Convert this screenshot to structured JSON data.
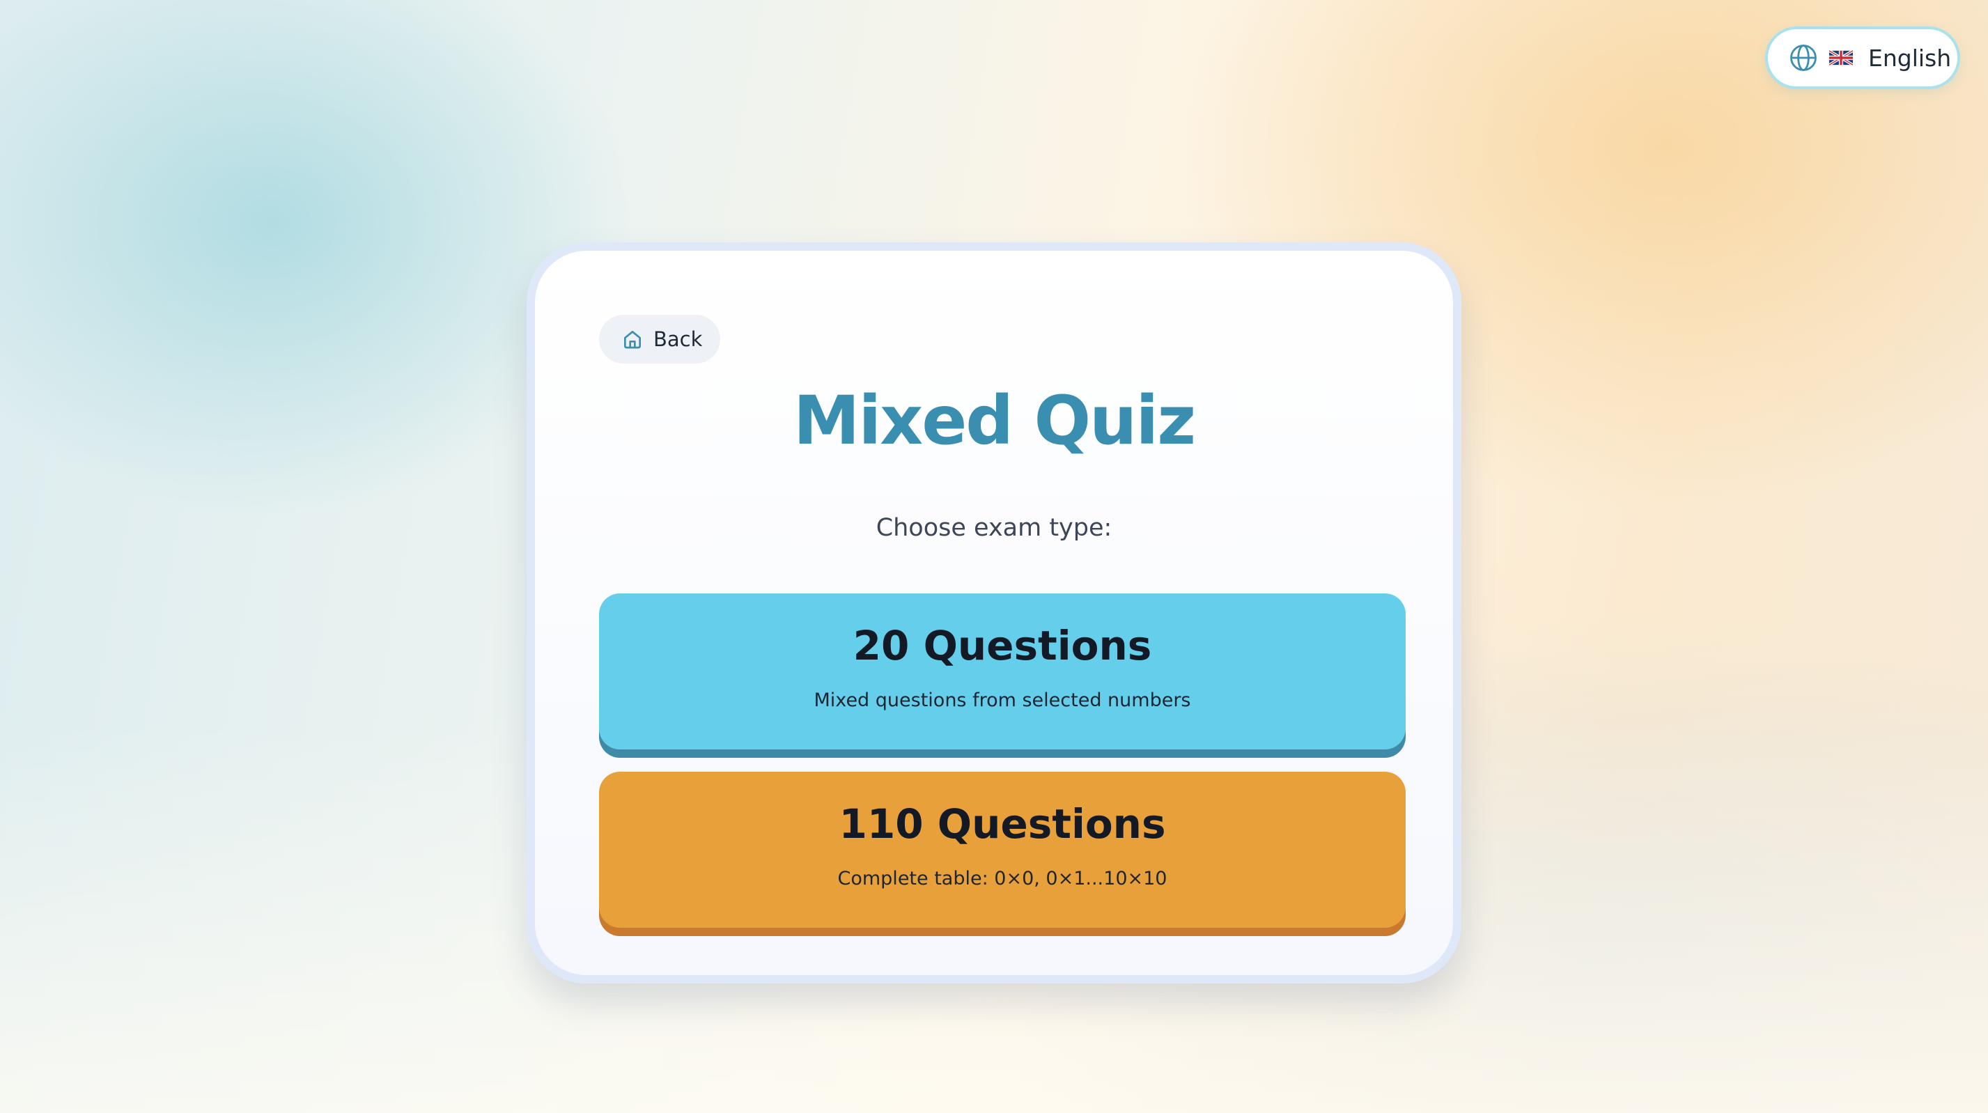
{
  "language": {
    "flag_icon": "uk-flag-icon",
    "globe_icon": "globe-icon",
    "label": "English"
  },
  "card": {
    "back_label": "Back",
    "back_icon": "home-icon",
    "title": "Mixed Quiz",
    "subtitle": "Choose exam type:",
    "options": [
      {
        "title": "20 Questions",
        "description": "Mixed questions from selected numbers",
        "color": "#65cfeb"
      },
      {
        "title": "110 Questions",
        "description": "Complete table: 0×0, 0×1...10×10",
        "color": "#e8a03b"
      }
    ]
  },
  "colors": {
    "title": "#3a8eb0",
    "card_border": "#dfe8f8",
    "pill_border": "#a9e2ec"
  }
}
